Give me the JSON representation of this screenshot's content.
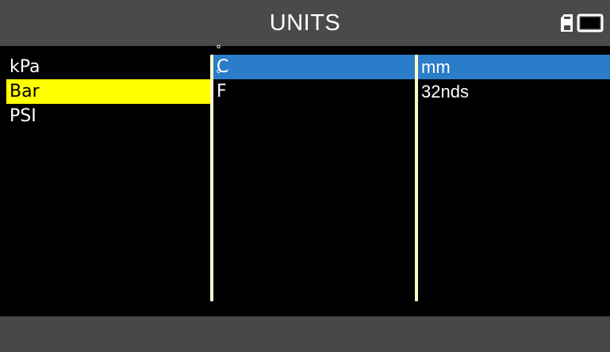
{
  "header": {
    "title": "UNITS",
    "icons": [
      "sd-card-icon",
      "battery-icon"
    ]
  },
  "columns": {
    "pressure": {
      "items": [
        "kPa",
        "Bar",
        "PSI"
      ],
      "selected": "Bar"
    },
    "temperature": {
      "items": [
        {
          "degree": "°",
          "letter": "C"
        },
        {
          "degree": "°",
          "letter": "F"
        }
      ],
      "selected": "°C"
    },
    "tread_depth": {
      "items": [
        "mm",
        "32nds"
      ],
      "selected": "mm"
    }
  },
  "colors": {
    "header_bg": "#4a4a4a",
    "footer_bg": "#474747",
    "selection_yellow": "#ffff00",
    "selection_blue": "#2b7cc9",
    "divider": "#fff9c8"
  }
}
